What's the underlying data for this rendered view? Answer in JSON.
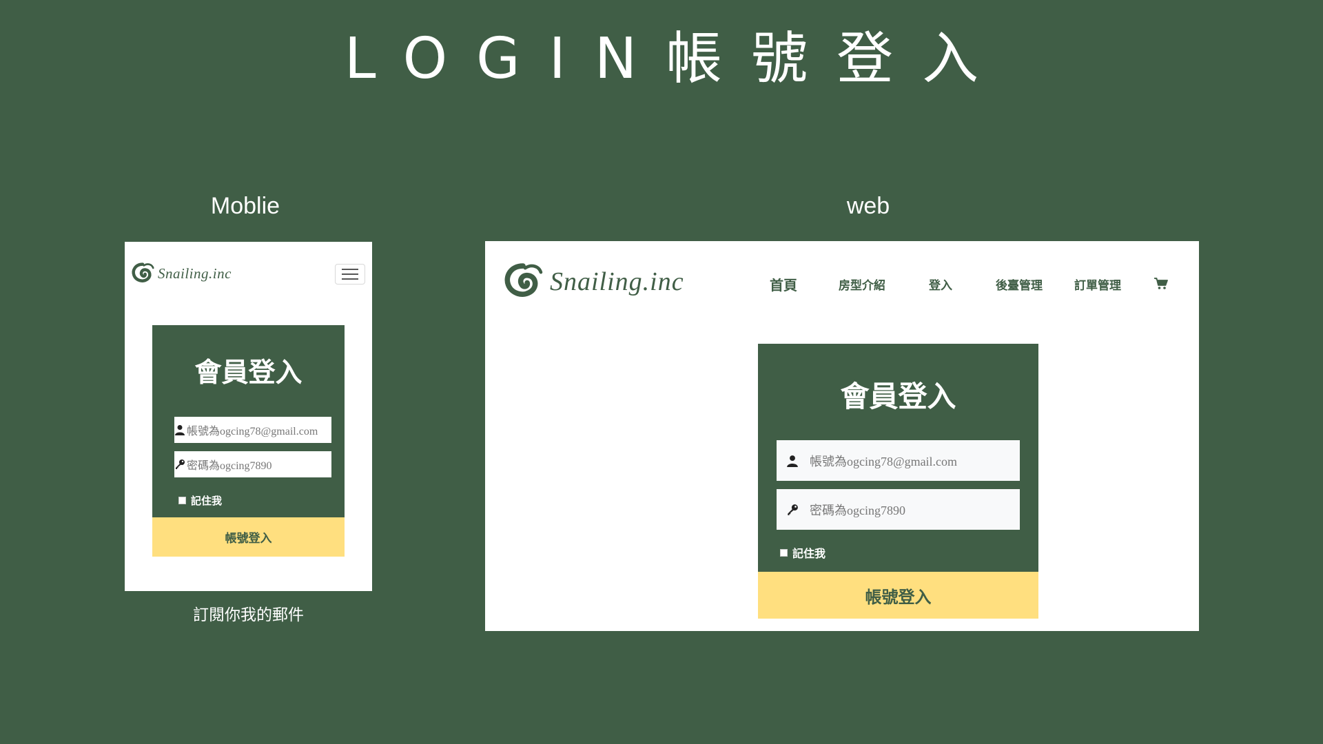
{
  "slide": {
    "title": "LOGIN帳號登入",
    "mobile_label": "Moblie",
    "web_label": "web",
    "mobile_caption": "訂閱你我的郵件"
  },
  "brand": {
    "name": "Snailing.inc",
    "logo_icon": "snail-swirl-icon",
    "color": "#405e46",
    "button_color": "#ffdf7f"
  },
  "mobile": {
    "menu_icon": "hamburger-menu-icon",
    "card": {
      "title": "會員登入",
      "account_placeholder": "帳號為ogcing78@gmail.com",
      "password_placeholder": "密碼為ogcing7890",
      "remember_label": "記住我",
      "submit_label": "帳號登入"
    }
  },
  "web": {
    "nav": [
      "首頁",
      "房型介紹",
      "登入",
      "後臺管理",
      "訂單管理"
    ],
    "cart_icon": "shopping-cart-icon",
    "card": {
      "title": "會員登入",
      "account_placeholder": "帳號為ogcing78@gmail.com",
      "password_placeholder": "密碼為ogcing7890",
      "remember_label": "記住我",
      "submit_label": "帳號登入"
    }
  }
}
